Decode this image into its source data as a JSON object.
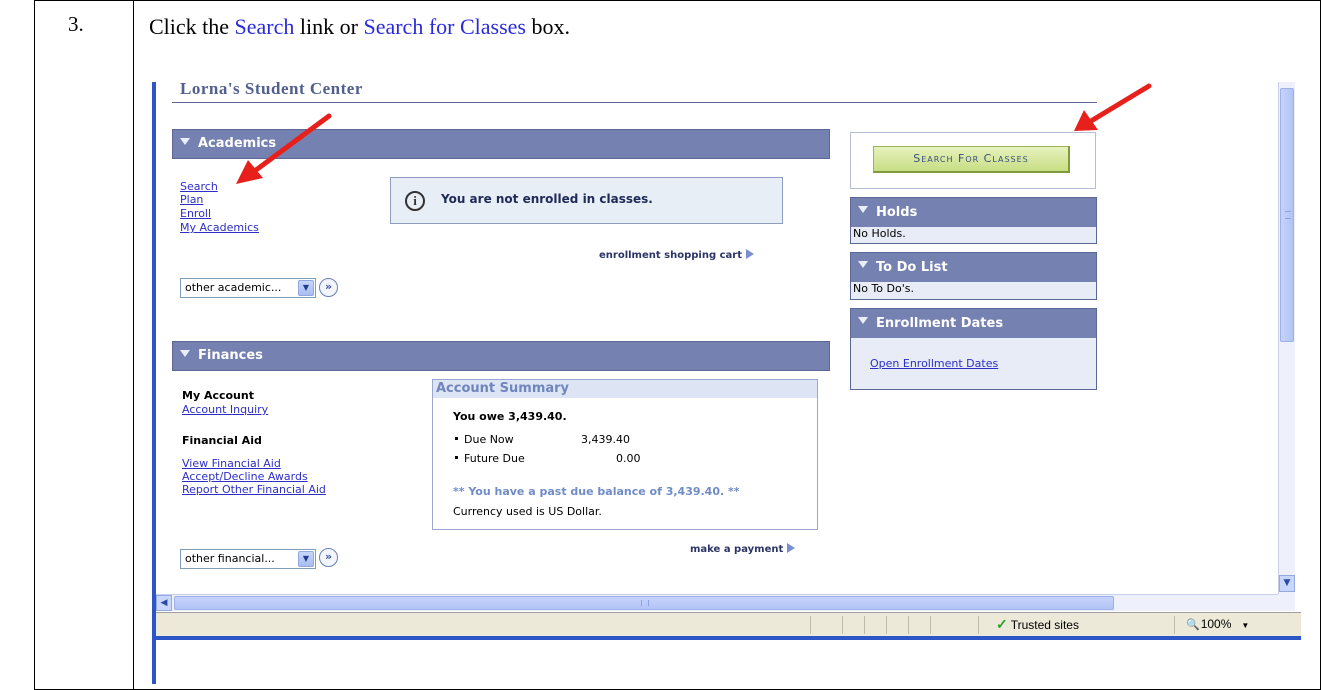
{
  "step": {
    "number": "3.",
    "text_before": "Click the ",
    "link1": "Search",
    "text_mid": " link or ",
    "link2": "Search for Classes",
    "text_after": " box."
  },
  "page": {
    "title": "Lorna's Student Center"
  },
  "academics": {
    "header": "Academics",
    "links": [
      "Search",
      "Plan",
      "Enroll",
      "My Academics"
    ],
    "notice": "You are not enrolled in classes.",
    "cart_link": "enrollment shopping cart",
    "select": "other academic...",
    "go_label": "»"
  },
  "finances": {
    "header": "Finances",
    "my_account_label": "My Account",
    "account_inquiry": "Account Inquiry",
    "financial_aid_label": "Financial Aid",
    "aid_links": [
      "View Financial Aid",
      "Accept/Decline Awards",
      "Report Other Financial Aid"
    ],
    "select": "other financial...",
    "go_label": "»",
    "payment_link": "make a payment",
    "summary": {
      "title": "Account Summary",
      "owe": "You owe 3,439.40.",
      "rows": [
        {
          "label": "Due Now",
          "amount": "3,439.40"
        },
        {
          "label": "Future Due",
          "amount": "0.00"
        }
      ],
      "past_due": "** You have a past due balance of 3,439.40. **",
      "currency": "Currency used is US Dollar."
    }
  },
  "sidebar": {
    "search_button": "Search For Classes",
    "holds": {
      "title": "Holds",
      "body": "No Holds."
    },
    "todo": {
      "title": "To Do List",
      "body": "No To Do's."
    },
    "enrollment": {
      "title": "Enrollment Dates",
      "link": "Open Enrollment Dates"
    }
  },
  "statusbar": {
    "trusted": "Trusted sites",
    "zoom": "100%"
  },
  "colors": {
    "arrow": "#e8201c",
    "section_bar": "#7581b0",
    "link": "#2e2ec6",
    "instruction_link": "#2a2add",
    "button_green": "#c7de84"
  }
}
